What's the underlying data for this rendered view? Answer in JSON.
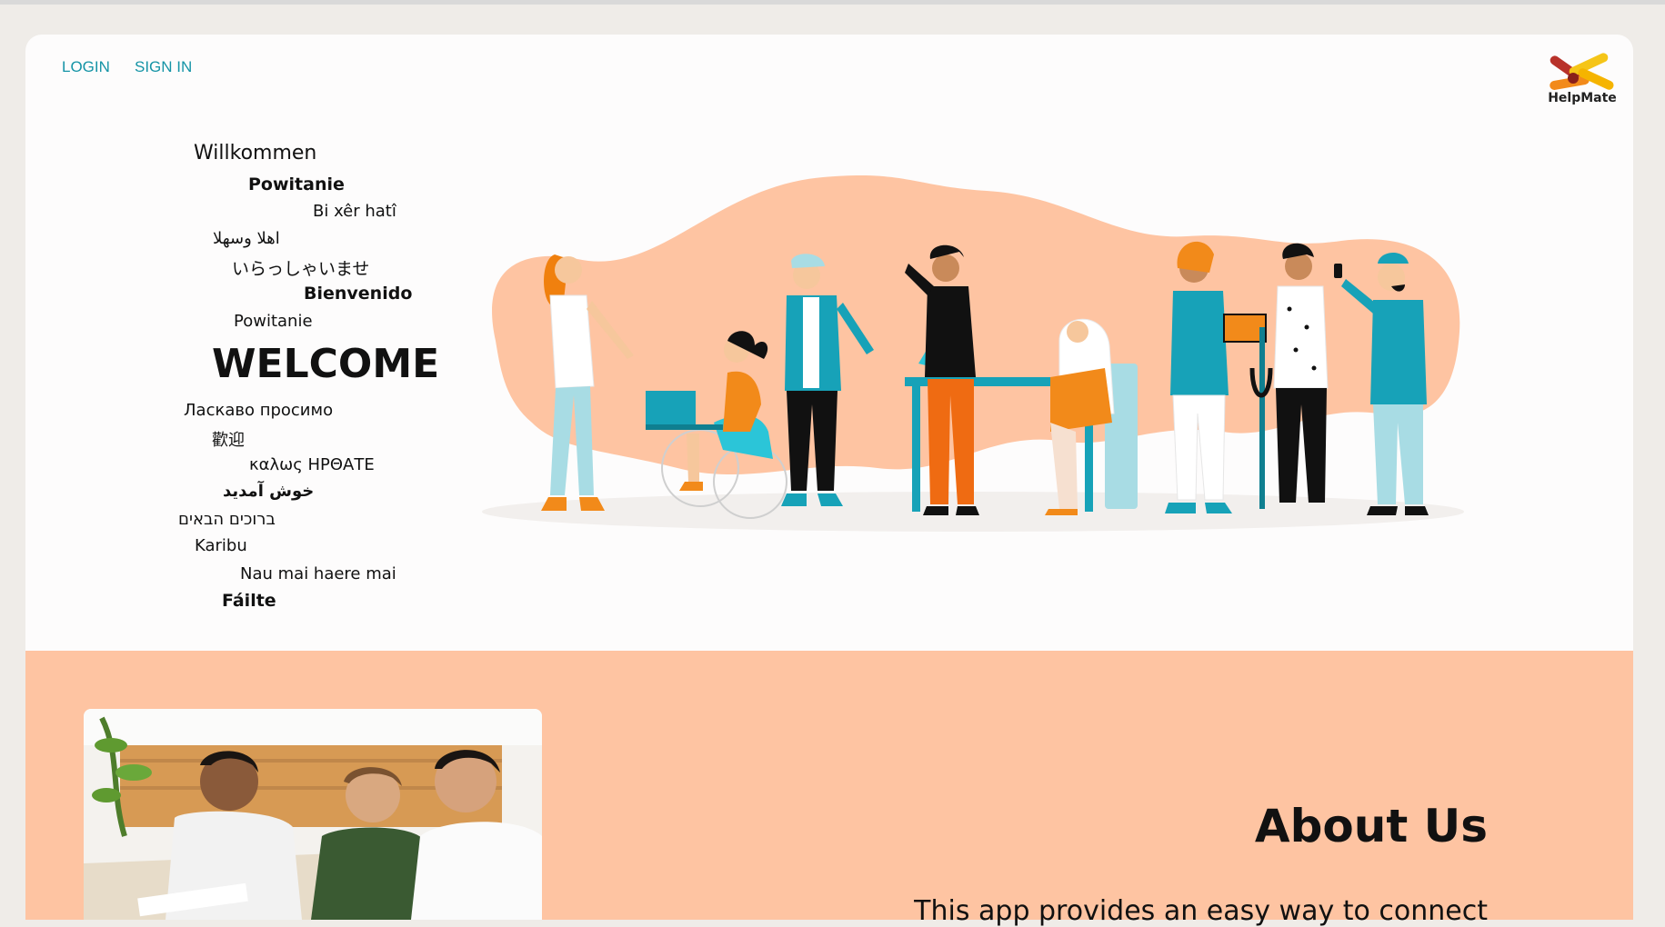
{
  "nav": {
    "login": "LOGIN",
    "signin": "SIGN IN"
  },
  "brand": {
    "name": "HelpMate"
  },
  "greetings": [
    "Willkommen",
    "Powitanie",
    "Bi xêr hatî",
    "اهلا وسهلا",
    "いらっしゃいませ",
    "Bienvenido",
    "Powitanie",
    "WELCOME",
    "Ласкаво просимо",
    "歡迎",
    "καλως ΗΡΘΑΤΕ",
    "خوش آمدید",
    "ברוכים הבאים",
    "Karibu",
    "Nau mai haere mai",
    "Fáilte"
  ],
  "hero": {
    "illustration": "diverse-people-group-illustration"
  },
  "about": {
    "title": "About Us",
    "text": "This app provides an easy way to connect",
    "photo": "students-studying-photo"
  },
  "colors": {
    "accent": "#1594a6",
    "peach": "#fec4a2",
    "orange": "#f28a1a",
    "teal": "#17a2b8"
  }
}
